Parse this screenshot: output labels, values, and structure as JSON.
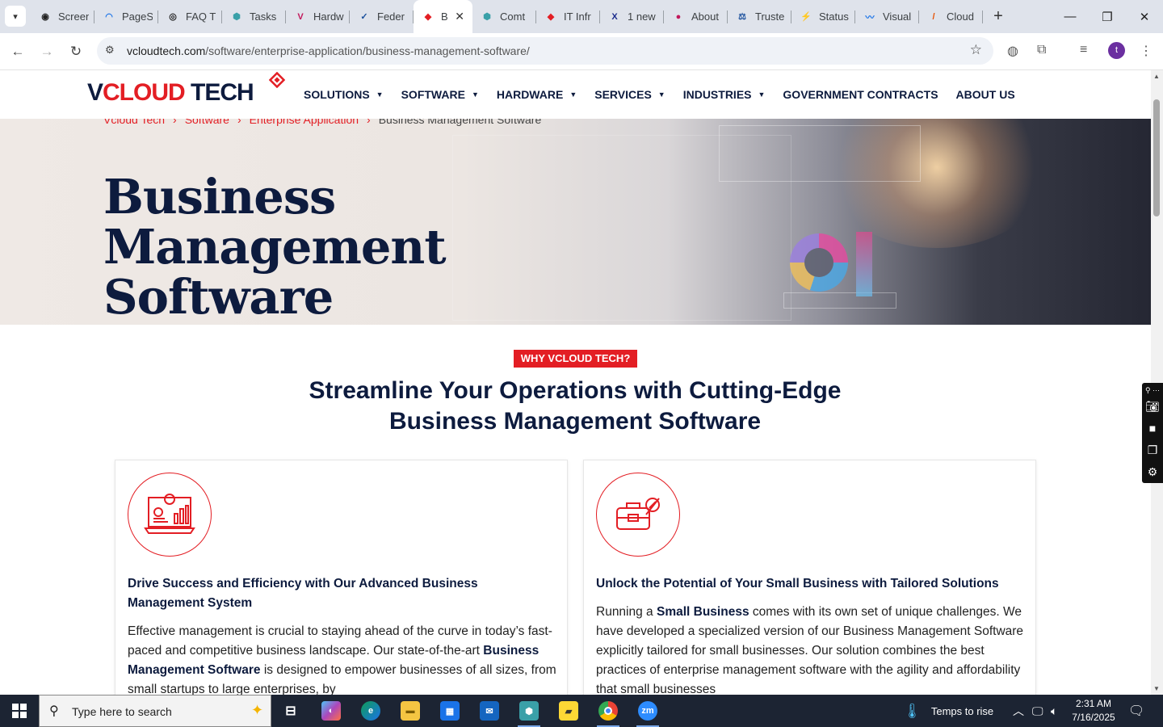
{
  "browser": {
    "tabs": [
      {
        "label": "Screen",
        "fav_color": "#222222",
        "fav_char": "◉"
      },
      {
        "label": "PageS",
        "fav_color": "#1a73e8",
        "fav_char": "◠"
      },
      {
        "label": "FAQ T",
        "fav_color": "#222222",
        "fav_char": "◎"
      },
      {
        "label": "Tasks",
        "fav_color": "#3aa0a8",
        "fav_char": "⬢"
      },
      {
        "label": "Hardw",
        "fav_color": "#c2185b",
        "fav_char": "V"
      },
      {
        "label": "Feder",
        "fav_color": "#1a4f9c",
        "fav_char": "✓"
      },
      {
        "label": "B",
        "fav_color": "#e31e24",
        "fav_char": "◆",
        "active": true
      },
      {
        "label": "Comt",
        "fav_color": "#3aa0a8",
        "fav_char": "⬢"
      },
      {
        "label": "IT Infr",
        "fav_color": "#e31e24",
        "fav_char": "◆"
      },
      {
        "label": "1 new",
        "fav_color": "#1a2b8c",
        "fav_char": "X"
      },
      {
        "label": "About",
        "fav_color": "#c2185b",
        "fav_char": "●"
      },
      {
        "label": "Truste",
        "fav_color": "#1a4f9c",
        "fav_char": "⚖"
      },
      {
        "label": "Status",
        "fav_color": "#d81b60",
        "fav_char": "⚡"
      },
      {
        "label": "Visual",
        "fav_color": "#1a73e8",
        "fav_char": "〰"
      },
      {
        "label": "Cloud",
        "fav_color": "#e65100",
        "fav_char": "/"
      }
    ],
    "url_host": "vcloudtech.com",
    "url_path": "/software/enterprise-application/business-management-software/",
    "profile_initial": "t"
  },
  "site": {
    "logo_v": "V",
    "logo_cloud": "CLOUD",
    "logo_tech": " TECH",
    "nav": [
      {
        "label": "SOLUTIONS",
        "dropdown": true
      },
      {
        "label": "SOFTWARE",
        "dropdown": true
      },
      {
        "label": "HARDWARE",
        "dropdown": true
      },
      {
        "label": "SERVICES",
        "dropdown": true
      },
      {
        "label": "INDUSTRIES",
        "dropdown": true
      },
      {
        "label": "GOVERNMENT CONTRACTS",
        "dropdown": false
      },
      {
        "label": "ABOUT US",
        "dropdown": false
      }
    ],
    "breadcrumb": [
      "Vcloud Tech",
      "Software",
      "Enterprise Application",
      "Business Management Software"
    ],
    "hero_title": "Business Management Software",
    "why_badge": "WHY VCLOUD TECH?",
    "why_title": "Streamline Your Operations with Cutting-Edge Business Management Software",
    "cards": [
      {
        "title": "Drive Success and Efficiency with Our Advanced Business Management System",
        "text_1": "Effective management is crucial to staying ahead of the curve in today’s fast-paced and competitive business landscape. Our state-of-the-art ",
        "text_bold": "Business Management Software",
        "text_2": " is designed to empower businesses of all sizes, from small startups to large enterprises, by"
      },
      {
        "title": "Unlock the Potential of Your Small Business with Tailored Solutions",
        "text_1": "Running a ",
        "text_bold": "Small Business",
        "text_2": " comes with its own set of unique challenges. We have developed a specialized version of our Business Management Software explicitly tailored for small businesses. Our solution combines the best practices of enterprise management software with the agility and affordability that small businesses"
      }
    ]
  },
  "taskbar": {
    "search_placeholder": "Type here to search",
    "weather": "Temps to rise",
    "time": "2:31 AM",
    "date": "7/16/2025"
  },
  "colors": {
    "brand_red": "#e31e24",
    "brand_navy": "#0d1b3e"
  }
}
